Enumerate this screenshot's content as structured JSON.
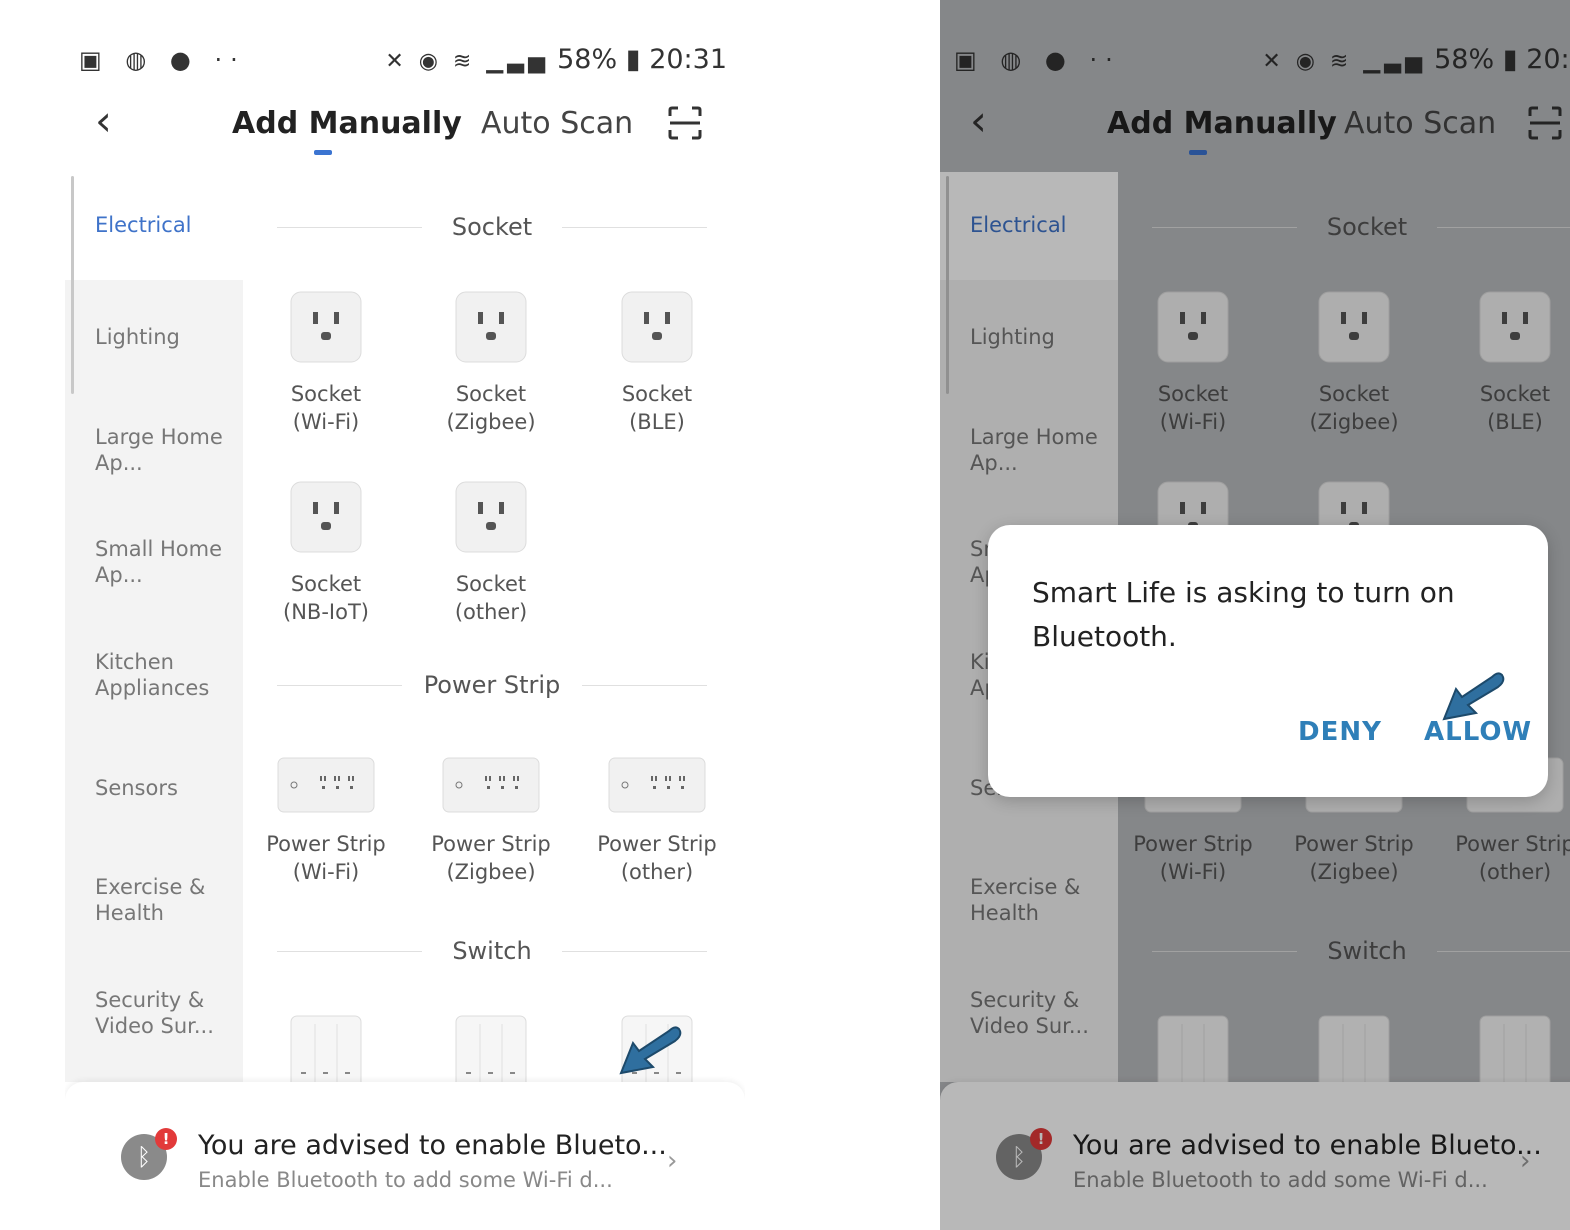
{
  "status_bar": {
    "battery": "58%",
    "time": "20:31",
    "left_icons": "gallery-icon, color-app-icon, bag-icon, more-dots",
    "right_icons": "mute-icon, alarm-icon, wifi-icon, signal-icon, battery-icon"
  },
  "header": {
    "back_icon": "back-chevron",
    "tab_active": "Add Manually",
    "tab_other": "Auto Scan",
    "scan_icon": "scan-icon"
  },
  "sidebar": {
    "items": [
      {
        "label": "Electrical",
        "selected": true
      },
      {
        "label": "Lighting"
      },
      {
        "label": "Large Home Ap..."
      },
      {
        "label": "Small Home Ap..."
      },
      {
        "label": "Kitchen Appliances"
      },
      {
        "label": "Sensors"
      },
      {
        "label": "Exercise & Health"
      },
      {
        "label": "Security & Video Sur..."
      }
    ]
  },
  "sections": {
    "socket": {
      "title": "Socket",
      "items": [
        {
          "line1": "Socket",
          "line2": "(Wi-Fi)"
        },
        {
          "line1": "Socket",
          "line2": "(Zigbee)"
        },
        {
          "line1": "Socket",
          "line2": "(BLE)"
        },
        {
          "line1": "Socket",
          "line2": "(NB-IoT)"
        },
        {
          "line1": "Socket",
          "line2": "(other)"
        }
      ]
    },
    "power_strip": {
      "title": "Power Strip",
      "items": [
        {
          "line1": "Power Strip",
          "line2": "(Wi-Fi)"
        },
        {
          "line1": "Power Strip",
          "line2": "(Zigbee)"
        },
        {
          "line1": "Power Strip",
          "line2": "(other)"
        }
      ]
    },
    "switch": {
      "title": "Switch"
    }
  },
  "bluetooth_banner": {
    "title": "You are advised to enable Blueto...",
    "subtitle": "Enable Bluetooth to add some Wi-Fi d...",
    "badge": "!",
    "icon": "bluetooth-icon"
  },
  "dialog": {
    "message": "Smart Life is asking to turn on Bluetooth.",
    "deny": "DENY",
    "allow": "ALLOW"
  },
  "colors": {
    "accent": "#3b74d1",
    "dialog_button": "#2f7fb8",
    "badge": "#e23a3a",
    "annotation_arrow": "#2f6f9f"
  }
}
